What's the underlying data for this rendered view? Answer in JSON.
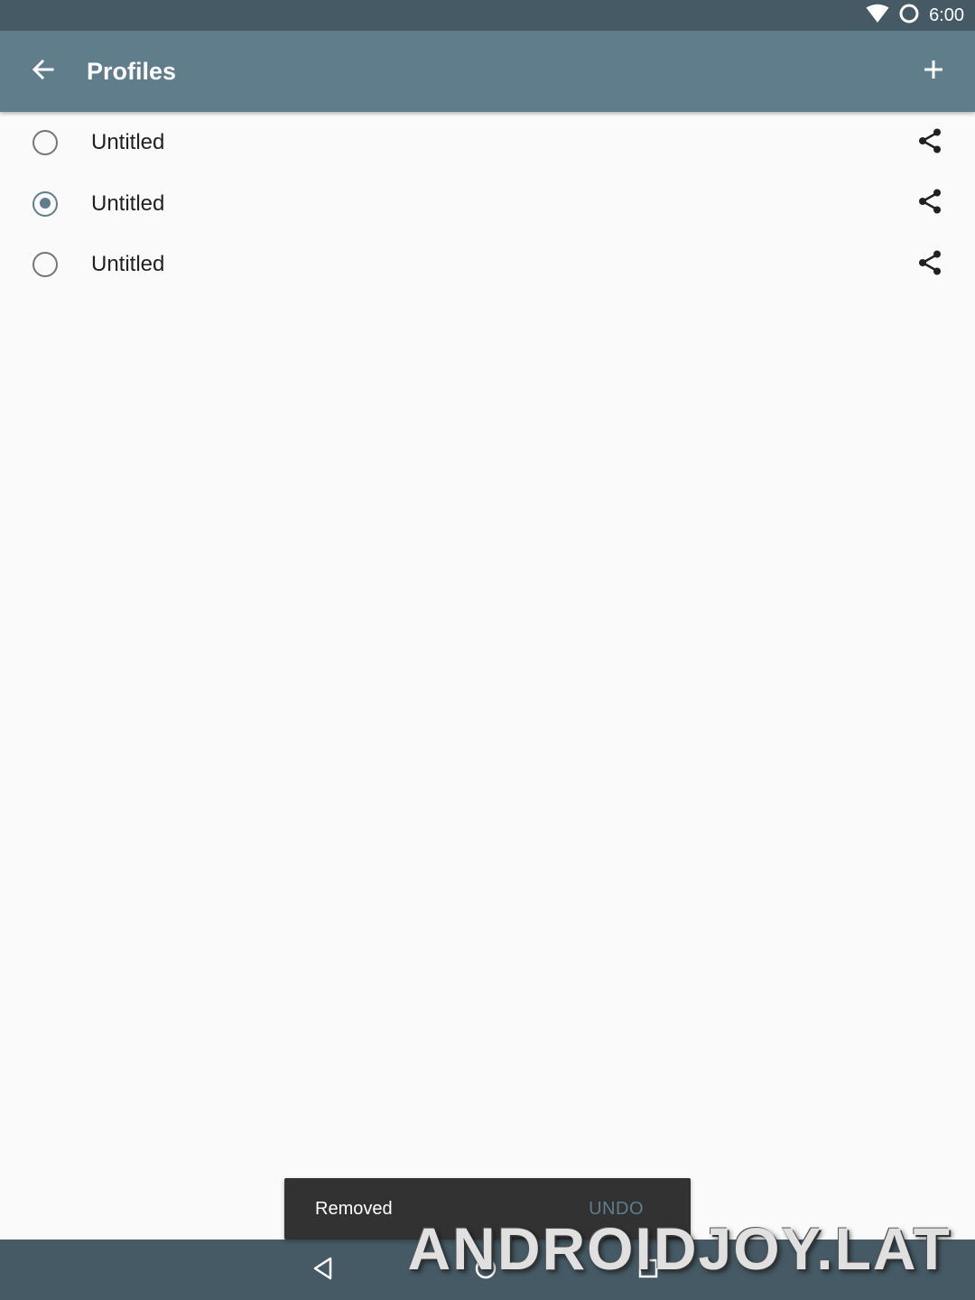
{
  "status_bar": {
    "time": "6:00",
    "icons": [
      "wifi-icon",
      "circle-status-icon"
    ]
  },
  "app_bar": {
    "title": "Profiles",
    "back_icon": "arrow-back-icon",
    "add_icon": "plus-icon"
  },
  "profiles": [
    {
      "name": "Untitled",
      "selected": false,
      "action_icon": "share-icon"
    },
    {
      "name": "Untitled",
      "selected": true,
      "action_icon": "share-icon"
    },
    {
      "name": "Untitled",
      "selected": false,
      "action_icon": "share-icon"
    }
  ],
  "snackbar": {
    "message": "Removed",
    "action": "UNDO"
  },
  "nav_bar": {
    "icons": [
      "nav-back-icon",
      "nav-home-icon",
      "nav-recents-icon"
    ]
  },
  "watermark": "ANDROIDJOY.LAT",
  "colors": {
    "status_bar": "#455a64",
    "app_bar": "#607d8b",
    "background": "#fafafa",
    "accent": "#607d8b",
    "snackbar": "#323232"
  }
}
